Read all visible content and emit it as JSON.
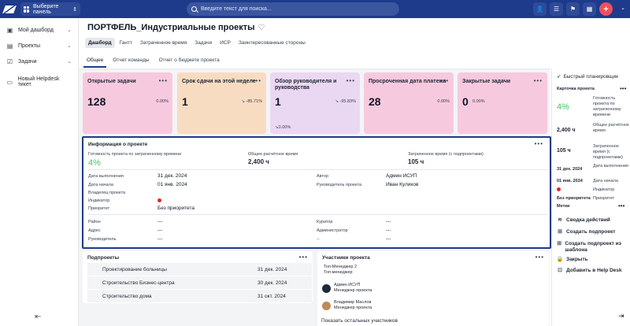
{
  "topbar": {
    "panel_select": "Выберите панель",
    "search_placeholder": "Введите текст для поиска..."
  },
  "sidebar": {
    "items": [
      {
        "label": "Мой дашборд",
        "icon": "dashboard-icon"
      },
      {
        "label": "Проекты",
        "icon": "projects-icon"
      },
      {
        "label": "Задачи",
        "icon": "tasks-icon"
      },
      {
        "label": "Новый Helpdesk тикет",
        "icon": "ticket-icon"
      }
    ]
  },
  "project": {
    "title": "ПОРТФЕЛЬ_Индустриальные проекты",
    "tabs": [
      "Дашборд",
      "Гантт",
      "Затраченное время",
      "Задачи",
      "ИСР",
      "Заинтересованные стороны"
    ],
    "subtabs": [
      "Общее",
      "Отчет команды",
      "Отчет о бюджете проекта"
    ]
  },
  "kpis": [
    {
      "title": "Открытые задачи",
      "value": "128",
      "pct": "0.00%",
      "color": "#f7c9df"
    },
    {
      "title": "Срок сдачи на этой неделе",
      "value": "1",
      "pct": "-85.71%",
      "color": "#f8dcc2"
    },
    {
      "title": "Обзор руководителя и руководства",
      "value": "1",
      "pct": "-95.83%",
      "extra": "0.00%",
      "color": "#ead8f3"
    },
    {
      "title": "Просроченная дата платежа",
      "value": "28",
      "pct": "0.00%",
      "color": "#f7c9df"
    },
    {
      "title": "Закрытые задачи",
      "value": "0",
      "pct": "0.00%",
      "color": "#f7c9df"
    }
  ],
  "info": {
    "title": "Информация о проекте",
    "readiness_label": "Готовность проекта по затраченному времени",
    "readiness_value": "4%",
    "estimated_label": "Общее расчётное время",
    "estimated_value": "2,400 ч",
    "spent_label": "Затраченное время (с подпроектами)",
    "spent_value": "105 ч",
    "fields": {
      "due_label": "Дата выполнения",
      "due_value": "31 дек. 2024",
      "start_label": "Дата начала",
      "start_value": "01 янв. 2024",
      "owner_label": "Владелец проекта",
      "indicator_label": "Индикатор",
      "priority_label": "Приоритет",
      "priority_value": "Без приоритета",
      "author_label": "Автор",
      "author_value": "Админ ИСУП",
      "manager_label": "Руководитель проекта",
      "manager_value": "Иван Куликов",
      "district_label": "Район",
      "district_value": "---",
      "address_label": "Адрес",
      "address_value": "---",
      "head_label": "Руководитель",
      "head_value": "---",
      "curator_label": "Куратор",
      "curator_value": "---",
      "admin_label": "Администратор",
      "admin_value": "---",
      "dash_label": "--",
      "dash_value": "---"
    }
  },
  "subprojects": {
    "title": "Подпроекты",
    "rows": [
      {
        "name": "Проектирование больницы",
        "date": "31 дек. 2024"
      },
      {
        "name": "Строительство Бизнес-центра",
        "date": "30 дек. 2024"
      },
      {
        "name": "Строительство дома",
        "date": "31 окт. 2024"
      }
    ]
  },
  "members": {
    "title": "Участники проекта",
    "top_manager": "Топ-Менеджер 2",
    "top_manager_role": "Топ-менеджер",
    "people": [
      {
        "name": "Админ ИСУП",
        "role": "Менеджер проекта"
      },
      {
        "name": "Владимир Маслов",
        "role": "Менеджер проекта"
      }
    ],
    "show_more": "Показать остальных участников"
  },
  "right_panel": {
    "quick_planner": "Быстрый планировщик",
    "card_title": "Карточка проекта",
    "pct_value": "4%",
    "pct_label": "Готовность проекта по затраченному времени",
    "est_value": "2,400 ч",
    "est_label": "Общее расчётное время",
    "spent_value": "105 ч",
    "spent_label": "Затраченное время (с подпроектами)",
    "due_value": "31 дек. 2024",
    "due_label": "Дата выполнения",
    "start_value": "01 янв. 2024",
    "start_label": "Дата начала",
    "indicator_label": "Индикатор",
    "priority_value": "Без приоритета",
    "priority_label": "Приоритет",
    "tags_label": "Метки",
    "actions": [
      {
        "label": "Сводка действий",
        "icon": "activity-icon"
      },
      {
        "label": "Создать подпроект",
        "icon": "add-subproject-icon"
      },
      {
        "label": "Создать подпроект из шаблона",
        "icon": "template-icon"
      },
      {
        "label": "Закрыть",
        "icon": "lock-icon"
      },
      {
        "label": "Добавить в Help Desk",
        "icon": "helpdesk-icon"
      }
    ]
  }
}
